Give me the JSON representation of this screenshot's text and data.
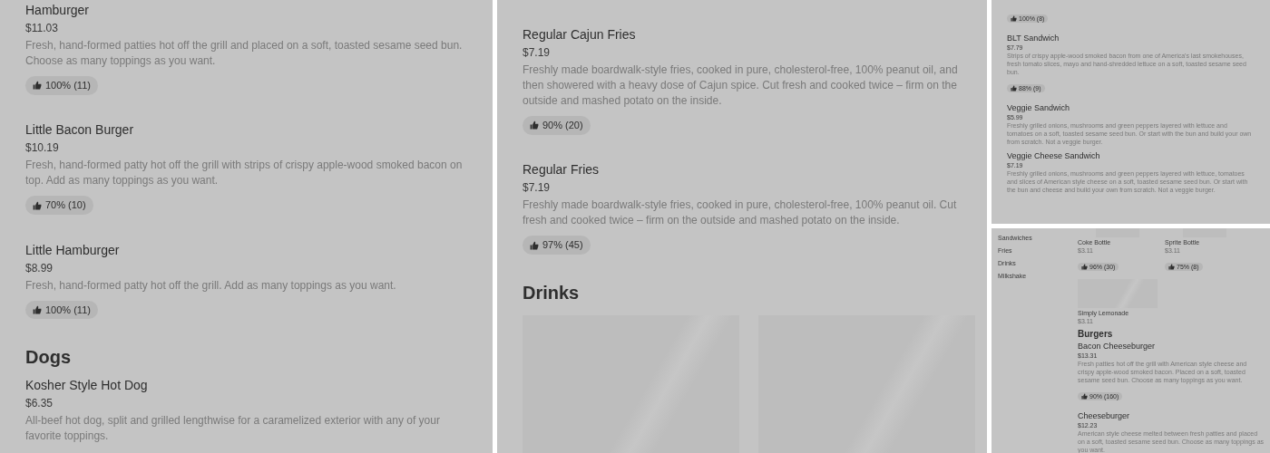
{
  "panels": [
    {
      "blocks": [
        {
          "kind": "item",
          "name": "Hamburger",
          "price": "$11.03",
          "description": "Fresh, hand-formed patties hot off the grill and placed on a soft, toasted sesame seed bun. Choose as many toppings as you want.",
          "rating": "100% (11)"
        },
        {
          "kind": "item",
          "name": "Little Bacon Burger",
          "price": "$10.19",
          "description": "Fresh, hand-formed patty hot off the grill with strips of crispy apple-wood smoked bacon on top. Add as many toppings as you want.",
          "rating": "70% (10)"
        },
        {
          "kind": "item",
          "name": "Little Hamburger",
          "price": "$8.99",
          "description": "Fresh, hand-formed patty hot off the grill. Add as many toppings as you want.",
          "rating": "100% (11)"
        },
        {
          "kind": "heading",
          "text": "Dogs"
        },
        {
          "kind": "item",
          "name": "Kosher Style Hot Dog",
          "price": "$6.35",
          "description": "All-beef hot dog, split and grilled lengthwise for a caramelized exterior with any of your favorite toppings."
        }
      ]
    },
    {
      "blocks": [
        {
          "kind": "item",
          "name": "Regular Cajun Fries",
          "price": "$7.19",
          "description": "Freshly made boardwalk-style fries, cooked in pure, cholesterol-free, 100% peanut oil, and then showered with a heavy dose of Cajun spice. Cut fresh and cooked twice – firm on the outside and mashed potato on the inside.",
          "rating": "90% (20)"
        },
        {
          "kind": "item",
          "name": "Regular Fries",
          "price": "$7.19",
          "description": "Freshly made boardwalk-style fries, cooked in pure, cholesterol-free, 100% peanut oil. Cut fresh and cooked twice – firm on the outside and mashed potato on the inside.",
          "rating": "97% (45)"
        },
        {
          "kind": "heading",
          "text": "Drinks"
        },
        {
          "kind": "tiles",
          "tiles": [
            {
              "kind": "placeholder"
            },
            {
              "kind": "placeholder"
            }
          ]
        }
      ]
    },
    {
      "blocks": [
        {
          "kind": "rating",
          "rating": "100% (8)"
        },
        {
          "kind": "item",
          "name": "BLT Sandwich",
          "price": "$7.79",
          "description": "Strips of crispy apple-wood smoked bacon from one of America's last smokehouses, fresh tomato slices, mayo and hand-shredded lettuce on a soft, toasted sesame seed bun.",
          "rating": "88% (9)"
        },
        {
          "kind": "item",
          "name": "Veggie Sandwich",
          "price": "$5.99",
          "description": "Freshly grilled onions, mushrooms and green peppers layered with lettuce and tomatoes on a soft, toasted sesame seed bun. Or start with the bun and build your own from scratch. Not a veggie burger."
        },
        {
          "kind": "item",
          "name": "Veggie Cheese Sandwich",
          "price": "$7.19",
          "description": "Freshly grilled onions, mushrooms and green peppers layered with lettuce, tomatoes and slices of American style cheese on a soft, toasted sesame seed bun. Or start with the bun and cheese and build your own from scratch. Not a veggie burger."
        }
      ]
    },
    {
      "nav": [
        "Sandwiches",
        "Fries",
        "Drinks",
        "Milkshake"
      ],
      "blocks": [
        {
          "kind": "tiles",
          "tiles": [
            {
              "kind": "picture",
              "name": "Coke Bottle",
              "price": "$3.11",
              "rating": "96% (30)"
            },
            {
              "kind": "picture",
              "name": "Sprite Bottle",
              "price": "$3.11",
              "rating": "75% (8)"
            },
            {
              "kind": "placeholder",
              "name": "Simply Lemonade",
              "price": "$3.11"
            }
          ]
        },
        {
          "kind": "heading",
          "text": "Burgers"
        },
        {
          "kind": "item",
          "name": "Bacon Cheeseburger",
          "price": "$13.31",
          "description": "Fresh patties hot off the grill with American style cheese and crispy apple-wood smoked bacon. Placed on a soft, toasted sesame seed bun. Choose as many toppings as you want.",
          "rating": "90% (160)"
        },
        {
          "kind": "item",
          "name": "Cheeseburger",
          "price": "$12.23",
          "description": "American style cheese melted between fresh patties and placed on a soft, toasted sesame seed bun. Choose as many toppings as you want."
        }
      ]
    }
  ]
}
